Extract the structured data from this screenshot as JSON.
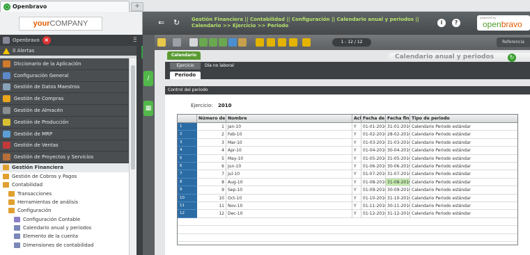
{
  "browser": {
    "tab_title": "Openbravo",
    "new_tab": "+"
  },
  "company": {
    "your": "your",
    "company": "COMPANY"
  },
  "user": {
    "name": "Openbravo",
    "alerts": "0 Alertas"
  },
  "menu": {
    "dark_items": [
      "Diccionario de la Aplicación",
      "Configuración General",
      "Gestión de Datos Maestros",
      "Gestión de Compras",
      "Gestión de Almacén",
      "Gestión de Producción",
      "Gestión de MRP",
      "Gestión de Ventas",
      "Gestión de Proyectos y Servicios"
    ],
    "dark_colors": [
      "#d07a2a",
      "#5b88c8",
      "#8aa2b8",
      "#e9a61b",
      "#8a8f94",
      "#d8c033",
      "#5c9fd6",
      "#c43a3a",
      "#b76f3a"
    ],
    "light_items": [
      {
        "label": "Gestión Financiera",
        "indent": 0,
        "bold": true,
        "color": "#e0a030"
      },
      {
        "label": "Gestión de Cobros y Pagos",
        "indent": 0,
        "bold": false,
        "color": "#e0a030"
      },
      {
        "label": "Contabilidad",
        "indent": 0,
        "bold": false,
        "color": "#e0a030"
      },
      {
        "label": "Transacciones",
        "indent": 1,
        "bold": false,
        "color": "#e0a030"
      },
      {
        "label": "Herramientas de análisis",
        "indent": 1,
        "bold": false,
        "color": "#e0a030"
      },
      {
        "label": "Configuración",
        "indent": 1,
        "bold": false,
        "color": "#e0a030"
      },
      {
        "label": "Configuración Contable",
        "indent": 2,
        "bold": false,
        "color": "#8a80c8"
      },
      {
        "label": "Calendario anual y periodos",
        "indent": 2,
        "bold": false,
        "color": "#7b88b8"
      },
      {
        "label": "Elemento de la cuenta",
        "indent": 2,
        "bold": false,
        "color": "#7b88b8"
      },
      {
        "label": "Dimensiones de contabilidad",
        "indent": 2,
        "bold": false,
        "color": "#7b88b8"
      }
    ]
  },
  "topbar": {
    "breadcrumb_line1": "Gestión Financiera || Contabilidad || Configuración || Calendario anual y periodos ||",
    "breadcrumb_line2": "Calendario >> Ejercicio >> Periodo",
    "back": "⇐",
    "refresh": "↻",
    "info": "i",
    "help": "?",
    "powered_by": "powered by",
    "logo_open": "open",
    "logo_bravo": "bravo"
  },
  "toolbar": {
    "pager": "1 - 12 / 12",
    "referencia": "Referencia"
  },
  "window": {
    "title_tab": "Calendario",
    "title": "Calendario anual y periodos",
    "tab_ejercicio": "Ejercicio",
    "tab_dia": "Día no laboral",
    "tab_periodo": "Periodo",
    "section": "Control del periodo",
    "field_label": "Ejercicio:",
    "field_value": "2010"
  },
  "grid": {
    "columns": [
      "Número de",
      "Nombre",
      "Acti",
      "Fecha de i",
      "Fecha fina",
      "Tipo de periodo"
    ],
    "rows": [
      {
        "n": "1",
        "num": "1",
        "name": "Jan-10",
        "act": "Y",
        "start": "01-01-2010",
        "end": "31-01-2010",
        "type": "Calendario Periodo estándar"
      },
      {
        "n": "2",
        "num": "2",
        "name": "Feb-10",
        "act": "Y",
        "start": "01-02-2010",
        "end": "28-02-2010",
        "type": "Calendario Periodo estándar"
      },
      {
        "n": "3",
        "num": "3",
        "name": "Mar-10",
        "act": "Y",
        "start": "01-03-2010",
        "end": "31-03-2010",
        "type": "Calendario Periodo estándar"
      },
      {
        "n": "4",
        "num": "4",
        "name": "Apr-10",
        "act": "Y",
        "start": "01-04-2010",
        "end": "30-04-2010",
        "type": "Calendario Periodo estándar"
      },
      {
        "n": "5",
        "num": "5",
        "name": "May-10",
        "act": "Y",
        "start": "01-05-2010",
        "end": "31-05-2010",
        "type": "Calendario Periodo estándar"
      },
      {
        "n": "6",
        "num": "6",
        "name": "Jun-10",
        "act": "Y",
        "start": "01-06-2010",
        "end": "30-06-2010",
        "type": "Calendario Periodo estándar"
      },
      {
        "n": "7",
        "num": "7",
        "name": "Jul-10",
        "act": "Y",
        "start": "01-07-2010",
        "end": "31-07-2010",
        "type": "Calendario Periodo estándar"
      },
      {
        "n": "8",
        "num": "8",
        "name": "Aug-10",
        "act": "Y",
        "start": "01-08-2010",
        "end": "31-08-2010",
        "type": "Calendario Periodo estándar"
      },
      {
        "n": "9",
        "num": "9",
        "name": "Sep-10",
        "act": "Y",
        "start": "01-09-2010",
        "end": "30-09-2010",
        "type": "Calendario Periodo estándar"
      },
      {
        "n": "10",
        "num": "10",
        "name": "Oct-10",
        "act": "Y",
        "start": "01-10-2010",
        "end": "31-10-2010",
        "type": "Calendario Periodo estándar"
      },
      {
        "n": "11",
        "num": "11",
        "name": "Nov-10",
        "act": "Y",
        "start": "01-11-2010",
        "end": "30-11-2010",
        "type": "Calendario Periodo estándar"
      },
      {
        "n": "12",
        "num": "12",
        "name": "Dec-10",
        "act": "Y",
        "start": "01-12-2010",
        "end": "31-12-2010",
        "type": "Calendario Periodo estándar"
      }
    ]
  },
  "colors": {
    "accent_green": "#52b84a",
    "row_number_blue": "#2c6ca5",
    "highlight": "#c6ebb0",
    "brand_orange": "#e65a00"
  }
}
